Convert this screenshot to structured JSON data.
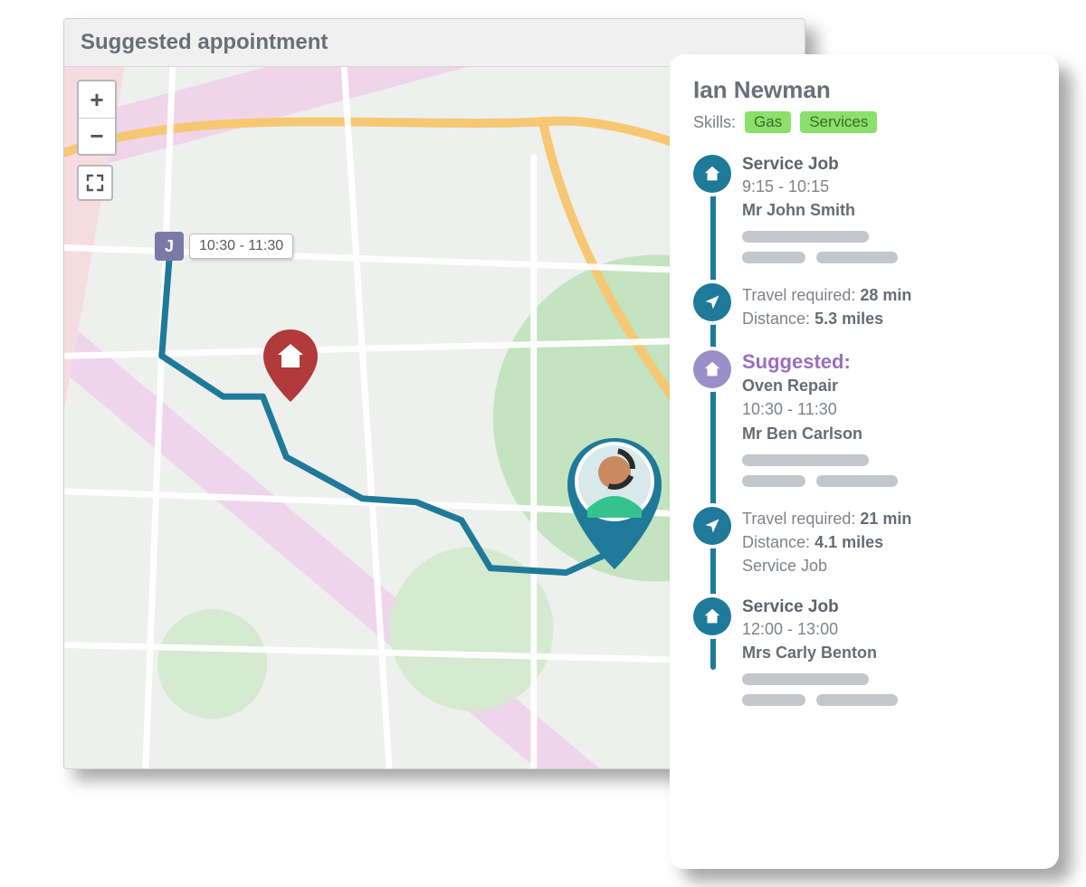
{
  "map_card": {
    "title": "Suggested appointment",
    "j_marker": {
      "letter": "J",
      "time_label": "10:30 - 11:30"
    }
  },
  "side_card": {
    "name": "Ian Newman",
    "skills_label": "Skills:",
    "skills": [
      "Gas",
      "Services"
    ],
    "timeline": [
      {
        "type": "job",
        "icon": "home",
        "icon_color": "teal",
        "title": "Service Job",
        "time": "9:15 - 10:15",
        "customer": "Mr John Smith"
      },
      {
        "type": "travel",
        "icon": "nav",
        "icon_color": "teal",
        "travel_label": "Travel required:",
        "travel_value": "28 min",
        "distance_label": "Distance:",
        "distance_value": "5.3 miles"
      },
      {
        "type": "suggested",
        "icon": "home",
        "icon_color": "purple",
        "suggested_label": "Suggested:",
        "title": "Oven Repair",
        "time": "10:30 - 11:30",
        "customer": "Mr Ben Carlson"
      },
      {
        "type": "travel",
        "icon": "nav",
        "icon_color": "teal",
        "travel_label": "Travel required:",
        "travel_value": "21 min",
        "distance_label": "Distance:",
        "distance_value": "4.1 miles",
        "extra": "Service Job"
      },
      {
        "type": "job",
        "icon": "home",
        "icon_color": "teal",
        "title": "Service Job",
        "time": "12:00 - 13:00",
        "customer": "Mrs Carly Benton"
      }
    ]
  }
}
